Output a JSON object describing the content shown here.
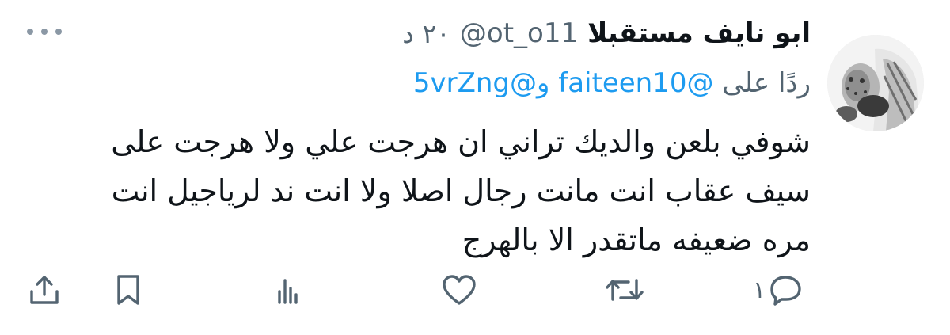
{
  "tweet": {
    "author_name": "ابو نايف مستقبلا",
    "handle": "@ot_o11",
    "time": "٢٠ د",
    "reply_prefix": "ردًا على",
    "reply_mentions": [
      "@faiteen10",
      "و",
      "@5vrZng"
    ],
    "text_lines": [
      "شوفي بلعن والديك تراني ان هرجت علي ولا هرجت على",
      "سيف عقاب انت مانت رجال اصلا ولا انت ند لرياجيل انت",
      "مره ضعيفه ماتقدر الا بالهرج"
    ]
  },
  "actions": {
    "reply_count": "١",
    "icons": [
      "reply-icon",
      "retweet-icon",
      "like-icon",
      "views-icon",
      "bookmark-icon",
      "share-icon"
    ]
  },
  "colors": {
    "text": "#0f1419",
    "secondary": "#536471",
    "link": "#1d9bf0",
    "background": "#ffffff"
  }
}
